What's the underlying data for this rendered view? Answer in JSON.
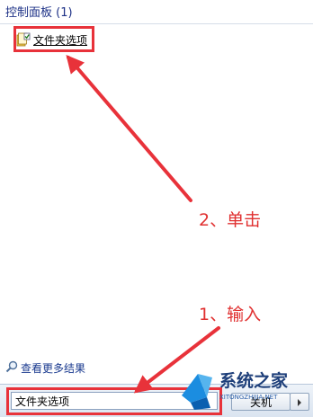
{
  "results_group": {
    "header": "控制面板 (1)",
    "items": [
      {
        "label": "文件夹选项",
        "icon": "folder-options-icon"
      }
    ]
  },
  "annotations": {
    "step1": "1、输入",
    "step2": "2、单击",
    "highlight_color": "#e8323a"
  },
  "more_results": {
    "label": "查看更多结果",
    "icon": "search-icon"
  },
  "search": {
    "value": "文件夹选项"
  },
  "shutdown": {
    "label": "关机",
    "icon": "chevron-right-icon"
  },
  "watermark": {
    "brand": "系统之家",
    "url": "XITONGZHIJIA.NET"
  }
}
